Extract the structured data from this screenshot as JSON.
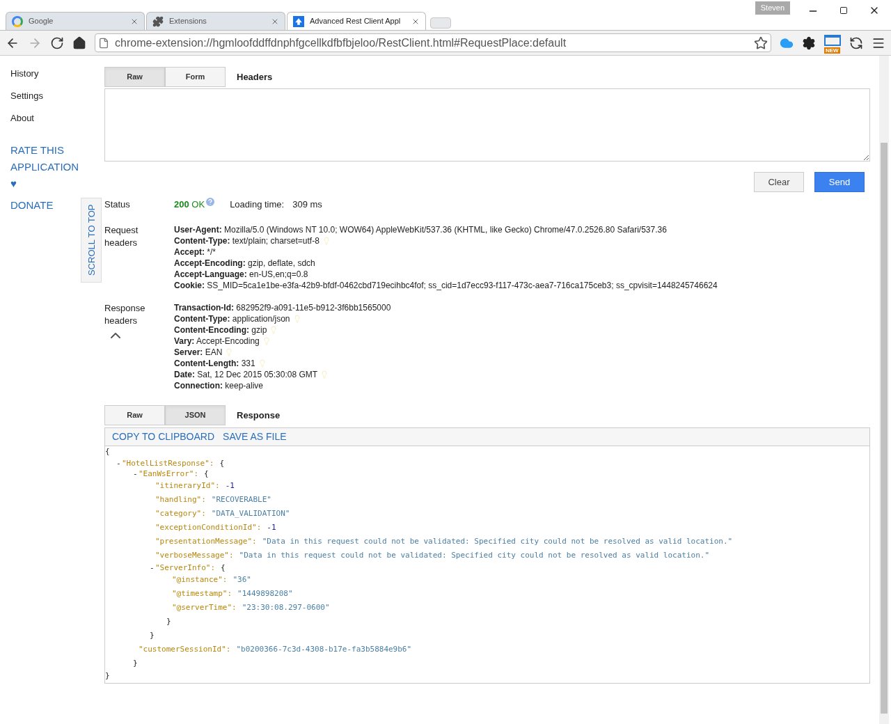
{
  "browser": {
    "profile": "Steven",
    "tabs": [
      {
        "title": "Google",
        "kind": "google",
        "selected": false
      },
      {
        "title": "Extensions",
        "kind": "puzzle",
        "selected": false
      },
      {
        "title": "Advanced Rest Client Appl",
        "kind": "arc",
        "selected": true
      }
    ],
    "address": "chrome-extension://hgmloofddffdnphfgcellkdfbfbjeloo/RestClient.html#RequestPlace:default",
    "extension_badge": "NEW"
  },
  "sidebar": {
    "items": [
      "History",
      "Settings",
      "About"
    ],
    "rate": "RATE THIS APPLICATION",
    "heart": "♥",
    "donate": "DONATE",
    "scroll_to_top": "SCROLL TO TOP"
  },
  "headers_editor": {
    "tabs": [
      {
        "label": "Raw",
        "selected": true
      },
      {
        "label": "Form",
        "selected": false
      }
    ],
    "title": "Headers"
  },
  "actions": [
    "Clear",
    "Send"
  ],
  "status": {
    "label": "Status",
    "code": "200",
    "text": "OK",
    "loading_label": "Loading time:",
    "loading_value": "309 ms"
  },
  "request_headers": {
    "label": "Request headers",
    "items": [
      {
        "name": "User-Agent:",
        "value": "Mozilla/5.0 (Windows NT 10.0; WOW64) AppleWebKit/537.36 (KHTML, like Gecko) Chrome/47.0.2526.80 Safari/537.36",
        "hint": false
      },
      {
        "name": "Content-Type:",
        "value": "text/plain; charset=utf-8",
        "hint": true
      },
      {
        "name": "Accept:",
        "value": "*/*",
        "hint": false
      },
      {
        "name": "Accept-Encoding:",
        "value": "gzip, deflate, sdch",
        "hint": false
      },
      {
        "name": "Accept-Language:",
        "value": "en-US,en;q=0.8",
        "hint": false
      },
      {
        "name": "Cookie:",
        "value": "SS_MID=5ca1e1be-e3fa-42b9-bfdf-0462cbd719ecihbc4fof; ss_cid=1d7ecc93-f117-473c-aea7-716ca175ceb3; ss_cpvisit=1448245746624",
        "hint": false
      }
    ]
  },
  "response_headers": {
    "label": "Response headers",
    "items": [
      {
        "name": "Transaction-Id:",
        "value": "682952f9-a091-11e5-b912-3f6bb1565000",
        "hint": false
      },
      {
        "name": "Content-Type:",
        "value": "application/json",
        "hint": true
      },
      {
        "name": "Content-Encoding:",
        "value": "gzip",
        "hint": true
      },
      {
        "name": "Vary:",
        "value": "Accept-Encoding",
        "hint": true
      },
      {
        "name": "Server:",
        "value": "EAN",
        "hint": true
      },
      {
        "name": "Content-Length:",
        "value": "331",
        "hint": true
      },
      {
        "name": "Date:",
        "value": "Sat, 12 Dec 2015 05:30:08 GMT",
        "hint": true
      },
      {
        "name": "Connection:",
        "value": "keep-alive",
        "hint": false
      }
    ]
  },
  "response": {
    "tabs": [
      {
        "label": "Raw",
        "selected": false
      },
      {
        "label": "JSON",
        "selected": true
      }
    ],
    "title": "Response",
    "links": [
      "COPY TO CLIPBOARD",
      "SAVE AS FILE"
    ],
    "tree": {
      "open": "{",
      "close": "}",
      "children": [
        {
          "kind": "object",
          "toggle": "-",
          "key": "\"HotelListResponse\":",
          "open": "{",
          "close": "}",
          "children": [
            {
              "kind": "object",
              "toggle": "-",
              "key": "\"EanWsError\":",
              "open": "{",
              "close": "}",
              "children": [
                {
                  "kind": "number",
                  "key": "\"itineraryId\":",
                  "value": "-1"
                },
                {
                  "kind": "string",
                  "key": "\"handling\":",
                  "value": "\"RECOVERABLE\""
                },
                {
                  "kind": "string",
                  "key": "\"category\":",
                  "value": "\"DATA_VALIDATION\""
                },
                {
                  "kind": "number",
                  "key": "\"exceptionConditionId\":",
                  "value": "-1"
                },
                {
                  "kind": "string",
                  "key": "\"presentationMessage\":",
                  "value": "\"Data in this request could not be validated: Specified city could not be resolved as valid location.\""
                },
                {
                  "kind": "string",
                  "key": "\"verboseMessage\":",
                  "value": "\"Data in this request could not be validated: Specified city could not be resolved as valid location.\""
                },
                {
                  "kind": "object",
                  "toggle": "-",
                  "key": "\"ServerInfo\":",
                  "open": "{",
                  "close": "}",
                  "children": [
                    {
                      "kind": "string",
                      "key": "\"@instance\":",
                      "value": "\"36\""
                    },
                    {
                      "kind": "string",
                      "key": "\"@timestamp\":",
                      "value": "\"1449898208\""
                    },
                    {
                      "kind": "string",
                      "key": "\"@serverTime\":",
                      "value": "\"23:30:08.297-0600\""
                    }
                  ]
                }
              ]
            },
            {
              "kind": "string",
              "key": "\"customerSessionId\":",
              "value": "\"b0200366-7c3d-4308-b17e-fa3b5884e9b6\""
            }
          ]
        }
      ]
    }
  }
}
